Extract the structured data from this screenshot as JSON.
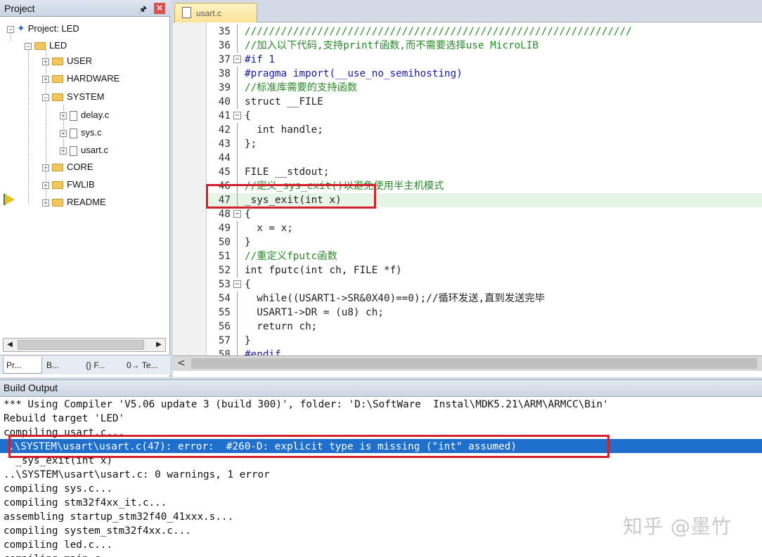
{
  "project_pane": {
    "title": "Project",
    "pin_icon": "pin-icon",
    "close_icon": "close-icon",
    "tree": {
      "root_label": "Project: LED",
      "target_label": "LED",
      "groups": [
        "USER",
        "HARDWARE",
        "SYSTEM",
        "CORE",
        "FWLIB",
        "README"
      ],
      "system_files": [
        "delay.c",
        "sys.c",
        "usart.c"
      ]
    },
    "tabs": [
      "Pr...",
      "B...",
      "{} F...",
      "0→ Te..."
    ]
  },
  "editor": {
    "tab_label": "usart.c",
    "lines": [
      {
        "num": "35",
        "fold": "",
        "text": "////////////////////////////////////////////////////////////////"
      },
      {
        "num": "36",
        "fold": "",
        "text": "//加入以下代码,支持printf函数,而不需要选择use MicroLIB"
      },
      {
        "num": "37",
        "fold": "−",
        "text": "#if 1"
      },
      {
        "num": "38",
        "fold": "",
        "text": "#pragma import(__use_no_semihosting)"
      },
      {
        "num": "39",
        "fold": "",
        "text": "//标准库需要的支持函数"
      },
      {
        "num": "40",
        "fold": "",
        "text": "struct __FILE"
      },
      {
        "num": "41",
        "fold": "−",
        "text": "{"
      },
      {
        "num": "42",
        "fold": "",
        "text": "  int handle;"
      },
      {
        "num": "43",
        "fold": "",
        "text": "};"
      },
      {
        "num": "44",
        "fold": "",
        "text": ""
      },
      {
        "num": "45",
        "fold": "",
        "text": "FILE __stdout;"
      },
      {
        "num": "46",
        "fold": "",
        "text": "//定义_sys_exit()以避免使用半主机模式"
      },
      {
        "num": "47",
        "fold": "",
        "text": "_sys_exit(int x)"
      },
      {
        "num": "48",
        "fold": "−",
        "text": "{"
      },
      {
        "num": "49",
        "fold": "",
        "text": "  x = x;"
      },
      {
        "num": "50",
        "fold": "",
        "text": "}"
      },
      {
        "num": "51",
        "fold": "",
        "text": "//重定义fputc函数"
      },
      {
        "num": "52",
        "fold": "",
        "text": "int fputc(int ch, FILE *f)"
      },
      {
        "num": "53",
        "fold": "−",
        "text": "{"
      },
      {
        "num": "54",
        "fold": "",
        "text": "  while((USART1->SR&0X40)==0);//循环发送,直到发送完毕"
      },
      {
        "num": "55",
        "fold": "",
        "text": "  USART1->DR = (u8) ch;"
      },
      {
        "num": "56",
        "fold": "",
        "text": "  return ch;"
      },
      {
        "num": "57",
        "fold": "",
        "text": "}"
      },
      {
        "num": "58",
        "fold": "",
        "text": "#endif"
      }
    ]
  },
  "build_output": {
    "title": "Build Output",
    "lines": [
      "*** Using Compiler 'V5.06 update 3 (build 300)', folder: 'D:\\SoftWare  Instal\\MDK5.21\\ARM\\ARMCC\\Bin'",
      "Rebuild target 'LED'",
      "compiling usart.c...",
      ".\\SYSTEM\\usart\\usart.c(47): error:  #260-D: explicit type is missing (\"int\" assumed)",
      "  _sys_exit(int x)",
      "..\\SYSTEM\\usart\\usart.c: 0 warnings, 1 error",
      "compiling sys.c...",
      "compiling stm32f4xx_it.c...",
      "assembling startup_stm32f40_41xxx.s...",
      "compiling system_stm32f4xx.c...",
      "compiling led.c...",
      "compiling main.c..."
    ],
    "selected_index": 3
  },
  "watermark": "知乎 @墨竹",
  "colors": {
    "selection": "#1f6fcd",
    "error_box": "#d4202a",
    "keyword": "#1a1aa6",
    "comment": "#2a8a2a",
    "current_line": "#e6f5e6"
  }
}
